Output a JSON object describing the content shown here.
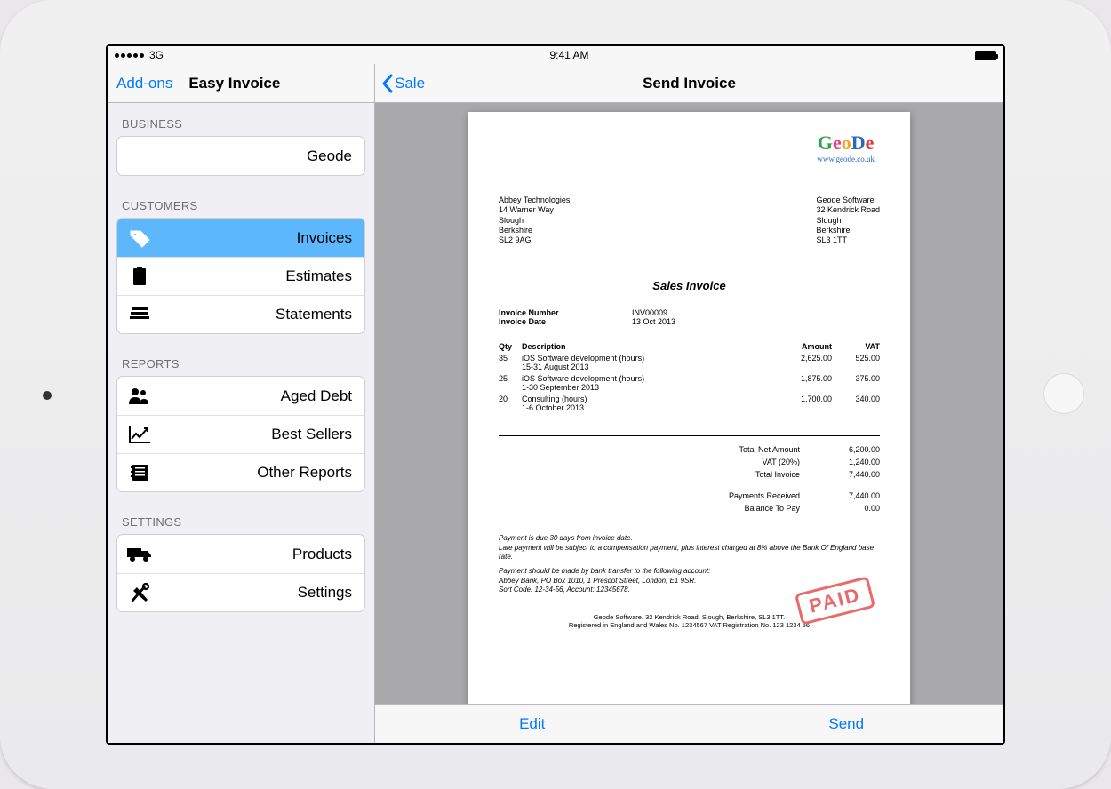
{
  "statusbar": {
    "carrier": "3G",
    "time": "9:41 AM"
  },
  "sidebar": {
    "addons": "Add-ons",
    "title": "Easy Invoice",
    "business_label": "BUSINESS",
    "business_value": "Geode",
    "customers_label": "CUSTOMERS",
    "customers": [
      {
        "label": "Invoices"
      },
      {
        "label": "Estimates"
      },
      {
        "label": "Statements"
      }
    ],
    "reports_label": "REPORTS",
    "reports": [
      {
        "label": "Aged Debt"
      },
      {
        "label": "Best Sellers"
      },
      {
        "label": "Other Reports"
      }
    ],
    "settings_label": "SETTINGS",
    "settings": [
      {
        "label": "Products"
      },
      {
        "label": "Settings"
      }
    ]
  },
  "detail": {
    "back": "Sale",
    "title": "Send Invoice",
    "edit": "Edit",
    "send": "Send"
  },
  "invoice": {
    "logo_url": "www.geode.co.uk",
    "to": {
      "name": "Abbey Technologies",
      "street": "14 Warner Way",
      "city": "Slough",
      "county": "Berkshire",
      "postcode": "SL2 9AG"
    },
    "from": {
      "name": "Geode Software",
      "street": "32 Kendrick Road",
      "city": "Slough",
      "county": "Berkshire",
      "postcode": "SL3 1TT"
    },
    "heading": "Sales Invoice",
    "number_label": "Invoice Number",
    "number": "INV00009",
    "date_label": "Invoice Date",
    "date": "13 Oct 2013",
    "col_qty": "Qty",
    "col_desc": "Description",
    "col_amount": "Amount",
    "col_vat": "VAT",
    "lines": [
      {
        "qty": "35",
        "desc": "iOS Software development (hours)",
        "sub": "15-31 August 2013",
        "amount": "2,625.00",
        "vat": "525.00"
      },
      {
        "qty": "25",
        "desc": "iOS Software development (hours)",
        "sub": "1-30 September 2013",
        "amount": "1,875.00",
        "vat": "375.00"
      },
      {
        "qty": "20",
        "desc": "Consulting (hours)",
        "sub": "1-6 October 2013",
        "amount": "1,700.00",
        "vat": "340.00"
      }
    ],
    "totals": {
      "net_label": "Total Net Amount",
      "net": "6,200.00",
      "vat_label": "VAT (20%)",
      "vat": "1,240.00",
      "total_label": "Total Invoice",
      "total": "7,440.00",
      "paid_label": "Payments Received",
      "paid": "7,440.00",
      "balance_label": "Balance To Pay",
      "balance": "0.00"
    },
    "stamp": "PAID",
    "terms1": "Payment is due 30 days from invoice date.",
    "terms2": "Late payment will be subject to a compensation payment, plus interest charged at 8% above the Bank Of England base rate.",
    "terms3": "Payment should be made by bank transfer to the following account:",
    "terms4": "Abbey Bank, PO Box 1010, 1 Prescot Street, London, E1 9SR.",
    "terms5": "Sort Code: 12-34-56, Account: 12345678.",
    "reg1": "Geode Software. 32 Kendrick Road, Slough, Berkshire, SL3 1TT.",
    "reg2": "Registered in England and Wales No. 1234567    VAT Registration No. 123 1234 56"
  }
}
